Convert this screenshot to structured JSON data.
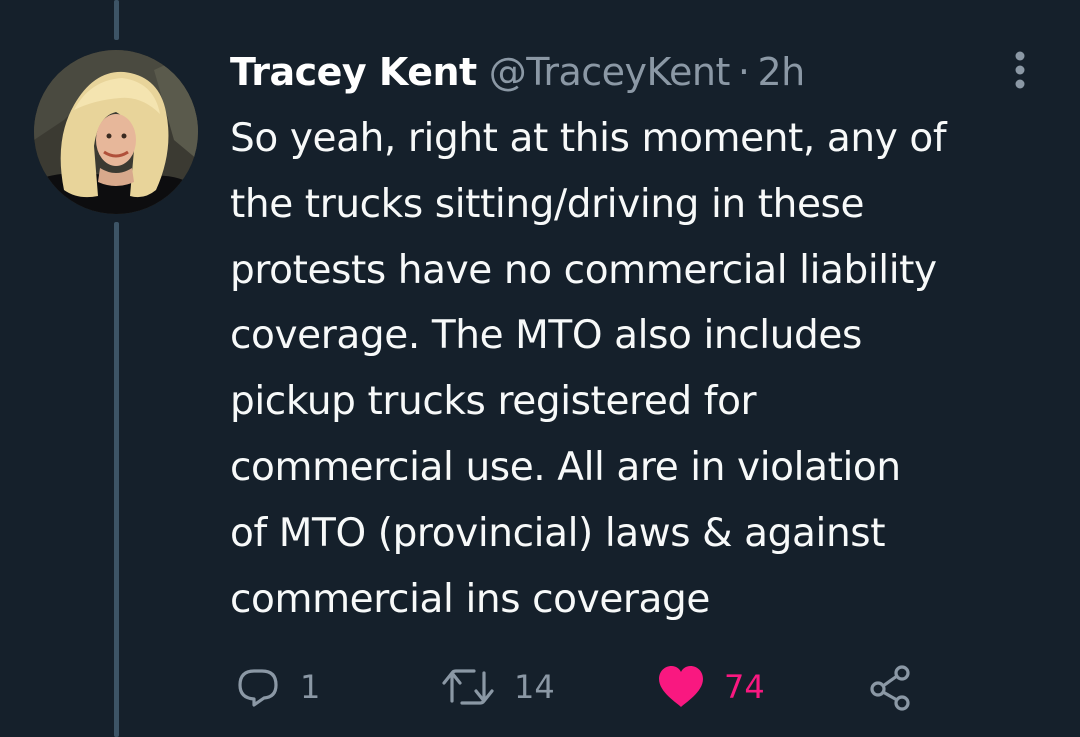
{
  "tweet": {
    "author": {
      "name": "Tracey Kent",
      "handle": "@TraceyKent",
      "separator": "·",
      "time": "2h"
    },
    "text": "So yeah, right at this moment, any of\nthe trucks sitting/driving  in these\nprotests have no commercial liability\ncoverage. The MTO also includes\npickup trucks registered for\ncommercial use. All are in violation\nof MTO (provincial) laws & against\ncommercial ins coverage",
    "actions": {
      "reply": {
        "icon": "reply-icon",
        "count": "1"
      },
      "retweet": {
        "icon": "retweet-icon",
        "count": "14"
      },
      "like": {
        "icon": "heart-icon",
        "count": "74",
        "liked": true,
        "color": "#f91880"
      },
      "share": {
        "icon": "share-icon"
      }
    },
    "menu_icon": "more-vertical-icon"
  },
  "theme": {
    "background": "#15202b",
    "text": "#f7f9f9",
    "muted": "#8b98a5",
    "thread_line": "#3d5466",
    "like": "#f91880"
  }
}
